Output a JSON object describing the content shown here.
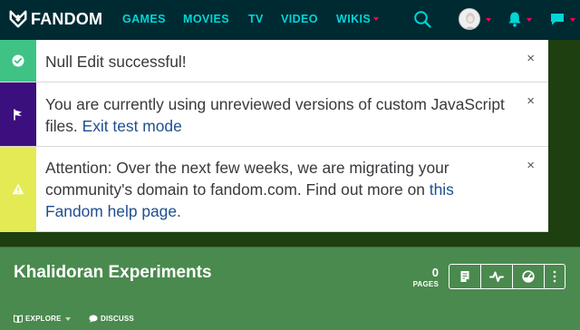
{
  "nav": {
    "brand": "FANDOM",
    "links": [
      "GAMES",
      "MOVIES",
      "TV",
      "VIDEO",
      "WIKIS"
    ],
    "icons": [
      "search-icon",
      "avatar",
      "bell-icon",
      "message-icon"
    ],
    "colors": {
      "bar": "#002a32",
      "link": "#00d6d6",
      "accent": "#fa005a"
    }
  },
  "banners": [
    {
      "type": "success",
      "color": "#3ec385",
      "text": "Null Edit successful!"
    },
    {
      "type": "notify",
      "color": "#3c0f7e",
      "text": "You are currently using unreviewed versions of custom JavaScript files. ",
      "link": "Exit test mode"
    },
    {
      "type": "warning",
      "color": "#e3ea53",
      "text": "Attention: Over the next few weeks, we are migrating your community's domain to fandom.com. Find out more on ",
      "link": "this Fandom help page."
    }
  ],
  "close_glyph": "×",
  "wiki": {
    "title": "Khalidoran Experiments",
    "pages_count": "0",
    "pages_label": "PAGES",
    "explore_label": "EXPLORE",
    "discuss_label": "DISCUSS",
    "header_color": "#4a8a4e"
  }
}
